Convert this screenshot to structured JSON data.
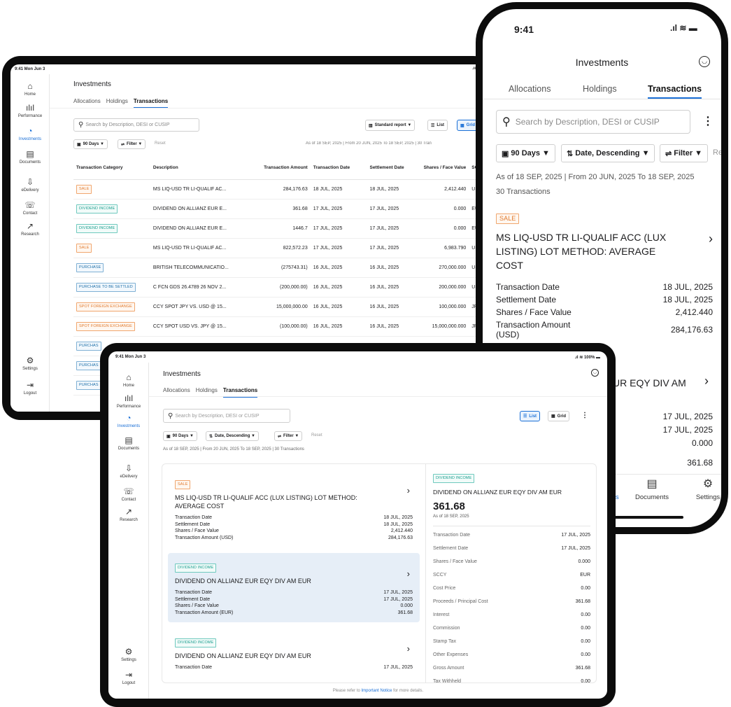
{
  "tablet1": {
    "status_left": "9:41 Mon Jun 3",
    "sidebar": [
      {
        "icon": "home-icon",
        "glyph": "⌂",
        "label": "Home",
        "active": false
      },
      {
        "icon": "performance-icon",
        "glyph": "ılıl",
        "label": "Performance",
        "active": false
      },
      {
        "icon": "investments-icon",
        "glyph": "◔",
        "label": "Investments",
        "active": true
      },
      {
        "icon": "documents-icon",
        "glyph": "▤",
        "label": "Documents",
        "active": false
      },
      {
        "icon": "edelivery-icon",
        "glyph": "⇩",
        "label": "eDelivery",
        "active": false
      },
      {
        "icon": "contact-icon",
        "glyph": "☏",
        "label": "Contact",
        "active": false
      },
      {
        "icon": "research-icon",
        "glyph": "↗",
        "label": "Research",
        "active": false
      }
    ],
    "sidebar_bottom": [
      {
        "icon": "settings-icon",
        "glyph": "⚙",
        "label": "Settings"
      },
      {
        "icon": "logout-icon",
        "glyph": "⇥",
        "label": "Logout"
      }
    ],
    "title": "Investments",
    "tabs": [
      "Allocations",
      "Holdings",
      "Transactions"
    ],
    "search_placeholder": "Search by Description, DESI or CUSIP",
    "report_label": "Standard report ▼",
    "list_label": "List",
    "grid_label": "Grid",
    "days_label": "90 Days ▼",
    "filter_label": "Filter ▼",
    "reset_label": "Reset",
    "as_of": "As of 18 SEP, 2025 | From 20 JUN, 2025 To 18 SEP, 2025 | 30 Tran",
    "columns": [
      "Transaction Category",
      "Description",
      "Transaction Amount",
      "Transaction Date",
      "Settlement Date",
      "Shares / Face Value",
      "SC"
    ],
    "rows": [
      {
        "cat": "SALE",
        "kind": "sale",
        "desc": "MS LIQ-USD TR LI-QUALIF AC...",
        "amt": "284,176.63",
        "tdate": "18 JUL, 2025",
        "sdate": "18 JUL, 2025",
        "shares": "2,412.440",
        "sc": "US"
      },
      {
        "cat": "DIVIDEND INCOME",
        "kind": "div",
        "desc": "DIVIDEND ON ALLIANZ EUR E...",
        "amt": "361.68",
        "tdate": "17 JUL, 2025",
        "sdate": "17 JUL, 2025",
        "shares": "0.000",
        "sc": "EU"
      },
      {
        "cat": "DIVIDEND INCOME",
        "kind": "div",
        "desc": "DIVIDEND ON ALLIANZ EUR E...",
        "amt": "1446.7",
        "tdate": "17 JUL, 2025",
        "sdate": "17 JUL, 2025",
        "shares": "0.000",
        "sc": "EU"
      },
      {
        "cat": "SALE",
        "kind": "sale",
        "desc": "MS LIQ-USD TR LI-QUALIF AC...",
        "amt": "822,572.23",
        "tdate": "17 JUL, 2025",
        "sdate": "17 JUL, 2025",
        "shares": "6,983.790",
        "sc": "US"
      },
      {
        "cat": "PURCHASE",
        "kind": "pur",
        "desc": "BRITISH TELECOMMUNICATIO...",
        "amt": "(275743.31)",
        "tdate": "16 JUL, 2025",
        "sdate": "16 JUL, 2025",
        "shares": "270,000.000",
        "sc": "US"
      },
      {
        "cat": "PURCHASE TO BE SETTLED",
        "kind": "pur",
        "desc": "C FCN GDS 26.4789 26 NOV 2...",
        "amt": "(200,000.00)",
        "tdate": "16 JUL, 2025",
        "sdate": "16 JUL, 2025",
        "shares": "200,000.000",
        "sc": "US"
      },
      {
        "cat": "SPOT FOREIGN EXCHANGE",
        "kind": "spot",
        "desc": "CCY SPOT JPY VS. USD @ 15...",
        "amt": "15,000,000.00",
        "tdate": "16 JUL, 2025",
        "sdate": "16 JUL, 2025",
        "shares": "100,000.000",
        "sc": "JP"
      },
      {
        "cat": "SPOT FOREIGN EXCHANGE",
        "kind": "spot",
        "desc": "CCY SPOT USD VS. JPY @ 15...",
        "amt": "(100,000.00)",
        "tdate": "16 JUL, 2025",
        "sdate": "16 JUL, 2025",
        "shares": "15,000,000.000",
        "sc": "JP"
      },
      {
        "cat": "PURCHAS",
        "kind": "pur",
        "desc": "",
        "amt": "",
        "tdate": "",
        "sdate": "",
        "shares": "",
        "sc": ""
      },
      {
        "cat": "PURCHAS",
        "kind": "pur",
        "desc": "",
        "amt": "",
        "tdate": "",
        "sdate": "",
        "shares": "",
        "sc": ""
      },
      {
        "cat": "PURCHAS",
        "kind": "pur",
        "desc": "",
        "amt": "",
        "tdate": "",
        "sdate": "",
        "shares": "",
        "sc": ""
      }
    ]
  },
  "phone": {
    "time": "9:41",
    "title": "Investments",
    "tabs": [
      "Allocations",
      "Holdings",
      "Transactions"
    ],
    "search_placeholder": "Search by Description, DESI or CUSIP",
    "days_label": "90 Days ▼",
    "sort_label": "Date, Descending ▼",
    "filter_label": "Filter ▼",
    "reset_label": "Re",
    "as_of": "As of 18 SEP, 2025 | From 20 JUN, 2025 To 18 SEP, 2025",
    "count": "30 Transactions",
    "card": {
      "badge": "SALE",
      "title": "MS LIQ-USD TR LI-QUALIF ACC (LUX LISTING) LOT METHOD: AVERAGE COST",
      "rows": [
        {
          "k": "Transaction Date",
          "v": "18 JUL, 2025"
        },
        {
          "k": "Settlement Date",
          "v": "18 JUL, 2025"
        },
        {
          "k": "Shares / Face Value",
          "v": "2,412.440"
        },
        {
          "k": "Transaction Amount (USD)",
          "v": "284,176.63"
        }
      ]
    },
    "partial_title": "UR EQY DIV AM",
    "partial_values": [
      "17 JUL, 2025",
      "17 JUL, 2025",
      "0.000",
      "361.68"
    ],
    "nav_partial": "nts",
    "nav": [
      {
        "icon": "documents-icon",
        "glyph": "▤",
        "label": "Documents"
      },
      {
        "icon": "settings-icon",
        "glyph": "⚙",
        "label": "Settings"
      }
    ]
  },
  "tablet2": {
    "status_left": "9:41 Mon Jun 3",
    "status_right": "100%",
    "title": "Investments",
    "tabs": [
      "Allocations",
      "Holdings",
      "Transactions"
    ],
    "search_placeholder": "Search by Description, DESI or CUSIP",
    "list_label": "List",
    "grid_label": "Grid",
    "days_label": "90 Days ▼",
    "sort_label": "Date, Descending ▼",
    "filter_label": "Filter ▼",
    "reset_label": "Reset",
    "as_of": "As of 18 SEP, 2025 | From 20 JUN, 2025 To 18 SEP, 2025 | 30 Transactions",
    "cards": [
      {
        "badge": "SALE",
        "kind": "sale",
        "selected": false,
        "title": "MS LIQ-USD TR LI-QUALIF ACC (LUX LISTING) LOT METHOD: AVERAGE COST",
        "rows": [
          {
            "k": "Transaction Date",
            "v": "18 JUL, 2025"
          },
          {
            "k": "Settlement Date",
            "v": "18 JUL, 2025"
          },
          {
            "k": "Shares / Face Value",
            "v": "2,412.440"
          },
          {
            "k": "Transaction Amount (USD)",
            "v": "284,176.63"
          }
        ]
      },
      {
        "badge": "DIVIDEND INCOME",
        "kind": "div",
        "selected": true,
        "title": "DIVIDEND ON ALLIANZ EUR EQY DIV AM EUR",
        "rows": [
          {
            "k": "Transaction Date",
            "v": "17 JUL, 2025"
          },
          {
            "k": "Settlement Date",
            "v": "17 JUL, 2025"
          },
          {
            "k": "Shares / Face Value",
            "v": "0.000"
          },
          {
            "k": "Transaction Amount (EUR)",
            "v": "361.68"
          }
        ]
      },
      {
        "badge": "DIVIDEND INCOME",
        "kind": "div",
        "selected": false,
        "title": "DIVIDEND ON ALLIANZ EUR EQY DIV AM EUR",
        "rows": [
          {
            "k": "Transaction Date",
            "v": "17 JUL, 2025"
          }
        ]
      }
    ],
    "detail": {
      "badge": "DIVIDEND INCOME",
      "title": "DIVIDEND ON ALLIANZ EUR EQY DIV AM EUR",
      "amount": "361.68",
      "as_of": "As of 18 SEP, 2025",
      "rows": [
        {
          "k": "Transaction Date",
          "v": "17 JUL, 2025"
        },
        {
          "k": "Settlement Date",
          "v": "17 JUL, 2025"
        },
        {
          "k": "Shares / Face Value",
          "v": "0.000"
        },
        {
          "k": "SCCY",
          "v": "EUR"
        },
        {
          "k": "Cost Price",
          "v": "0.00"
        },
        {
          "k": "Proceeds / Principal Cost",
          "v": "361.68"
        },
        {
          "k": "Interest",
          "v": "0.00"
        },
        {
          "k": "Commission",
          "v": "0.00"
        },
        {
          "k": "Stamp Tax",
          "v": "0.00"
        },
        {
          "k": "Other Expenses",
          "v": "0.00"
        },
        {
          "k": "Gross Amount",
          "v": "361.68"
        },
        {
          "k": "Tax Withheld",
          "v": "0.00"
        }
      ]
    },
    "footer_prefix": "Please refer to ",
    "footer_link": "Important Notice",
    "footer_suffix": " for more details."
  }
}
